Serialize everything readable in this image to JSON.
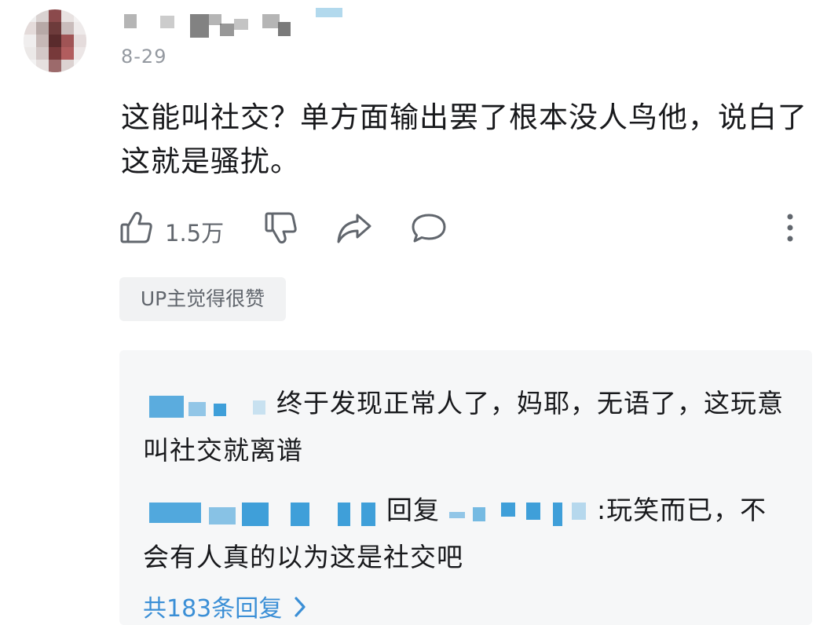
{
  "comment": {
    "date": "8-29",
    "text": "这能叫社交？单方面输出罢了根本没人鸟他，说白了这就是骚扰。",
    "like_count": "1.5万",
    "up_badge": "UP主觉得很赞"
  },
  "replies": [
    {
      "text": "终于发现正常人了，妈耶，无语了，这玩意叫社交就离谱"
    },
    {
      "reply_word": "回复",
      "text_tail": ":玩笑而已，不会有人真的以为这是社交吧"
    }
  ],
  "view_more": {
    "label": "共183条回复"
  },
  "icons": {
    "like": "thumbs-up-icon",
    "dislike": "thumbs-down-icon",
    "share": "share-icon",
    "reply": "speech-bubble-icon",
    "more": "more-vertical-icon",
    "chevron": "chevron-right-icon"
  },
  "colors": {
    "link_blue": "#3b8fd6",
    "muted": "#9499a0",
    "text": "#18191c"
  }
}
